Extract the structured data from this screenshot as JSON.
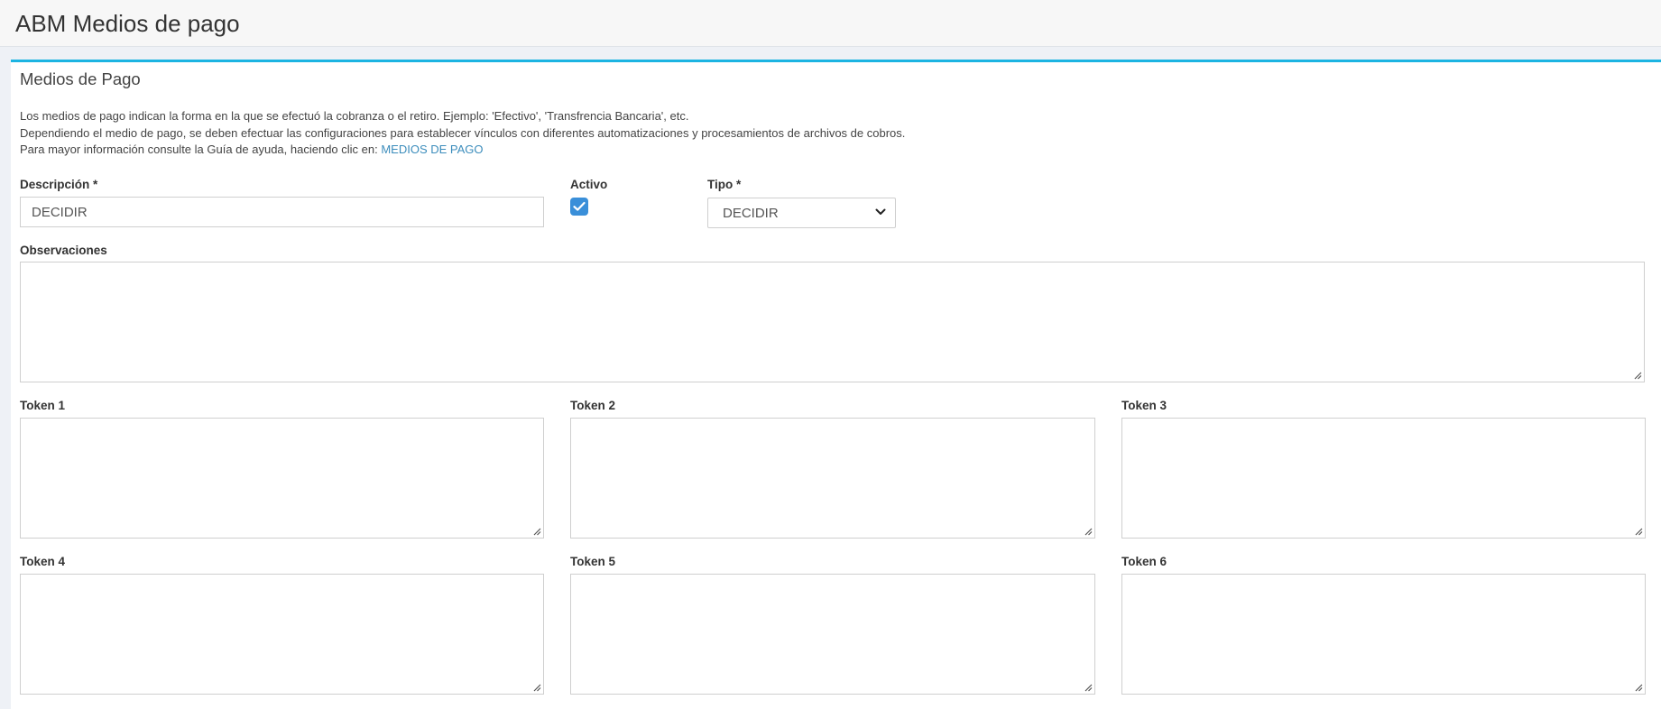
{
  "header": {
    "title": "ABM Medios de pago"
  },
  "panel": {
    "title": "Medios de Pago",
    "help": {
      "line1": "Los medios de pago indican la forma en la que se efectuó la cobranza o el retiro. Ejemplo: 'Efectivo', 'Transfrencia Bancaria', etc.",
      "line2": "Dependiendo el medio de pago, se deben efectuar las configuraciones para establecer vínculos con diferentes automatizaciones y procesamientos de archivos de cobros.",
      "line3_prefix": "Para mayor información consulte la Guía de ayuda, haciendo clic en: ",
      "link_label": "MEDIOS DE PAGO"
    }
  },
  "form": {
    "descripcion": {
      "label": "Descripción *",
      "value": "DECIDIR"
    },
    "activo": {
      "label": "Activo",
      "checked": true
    },
    "tipo": {
      "label": "Tipo *",
      "selected": "DECIDIR"
    },
    "observaciones": {
      "label": "Observaciones",
      "value": ""
    },
    "tokens": [
      {
        "label": "Token 1",
        "value": ""
      },
      {
        "label": "Token 2",
        "value": ""
      },
      {
        "label": "Token 3",
        "value": ""
      },
      {
        "label": "Token 4",
        "value": ""
      },
      {
        "label": "Token 5",
        "value": ""
      },
      {
        "label": "Token 6",
        "value": ""
      }
    ]
  },
  "icons": {
    "checkbox_checked": "check-icon",
    "select_arrow": "chevron-down-icon",
    "resize_handle": "resize-grip-icon"
  },
  "colors": {
    "accent": "#1cb4e2",
    "link": "#3c8dbc",
    "checkbox": "#3a8fd9",
    "page_bg": "#eef1f6"
  }
}
